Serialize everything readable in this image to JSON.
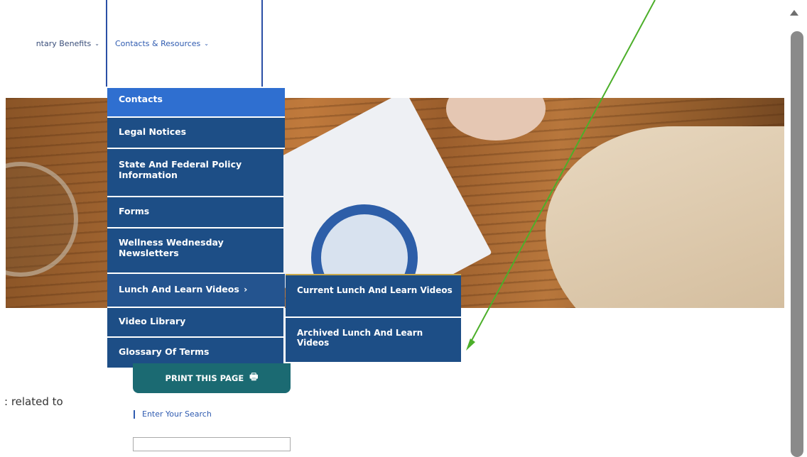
{
  "nav": {
    "supplementary_label": "ntary Benefits",
    "contacts_label": "Contacts & Resources",
    "chevron": "⌄"
  },
  "dropdown": {
    "items": [
      {
        "label": "Contacts"
      },
      {
        "label": "Legal Notices"
      },
      {
        "label": "State And Federal Policy Information"
      },
      {
        "label": "Forms"
      },
      {
        "label": "Wellness Wednesday Newsletters"
      },
      {
        "label": "Lunch And Learn Videos"
      },
      {
        "label": "Video Library"
      },
      {
        "label": "Glossary Of Terms"
      }
    ],
    "submenu_arrow": "›"
  },
  "submenu": {
    "items": [
      {
        "label": "Current Lunch And Learn Videos"
      },
      {
        "label": "Archived Lunch And Learn Videos"
      }
    ]
  },
  "print_button": {
    "label": "PRINT THIS PAGE",
    "icon": "printer-icon"
  },
  "body_text": {
    "related": ": related to"
  },
  "search": {
    "label": "Enter Your Search"
  },
  "colors": {
    "menu_bg": "#1d4e86",
    "menu_active": "#2f6fd0",
    "print_button_bg": "#1b6a72",
    "annotation_arrow": "#4caf2a"
  }
}
